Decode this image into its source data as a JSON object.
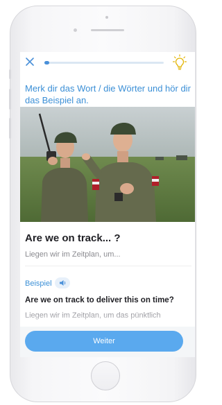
{
  "topbar": {
    "close_icon": "close-icon",
    "progress_fraction": 0.04,
    "hint_icon": "lightbulb-icon"
  },
  "instruction": "Merk dir das Wort / die Wörter und hör dir das Beispiel an.",
  "image": {
    "description_icon": "photo-soldiers"
  },
  "word": {
    "term": "Are we on track... ?",
    "translation": "Liegen wir im Zeitplan, um..."
  },
  "example": {
    "label": "Beispiel",
    "audio_icon": "speaker-icon",
    "sentence": "Are we on track to deliver this on time?",
    "translation": "Liegen wir im Zeitplan, um das pünktlich"
  },
  "footer": {
    "continue_label": "Weiter"
  },
  "colors": {
    "accent": "#3b8fd6",
    "button": "#5aa9ee"
  }
}
